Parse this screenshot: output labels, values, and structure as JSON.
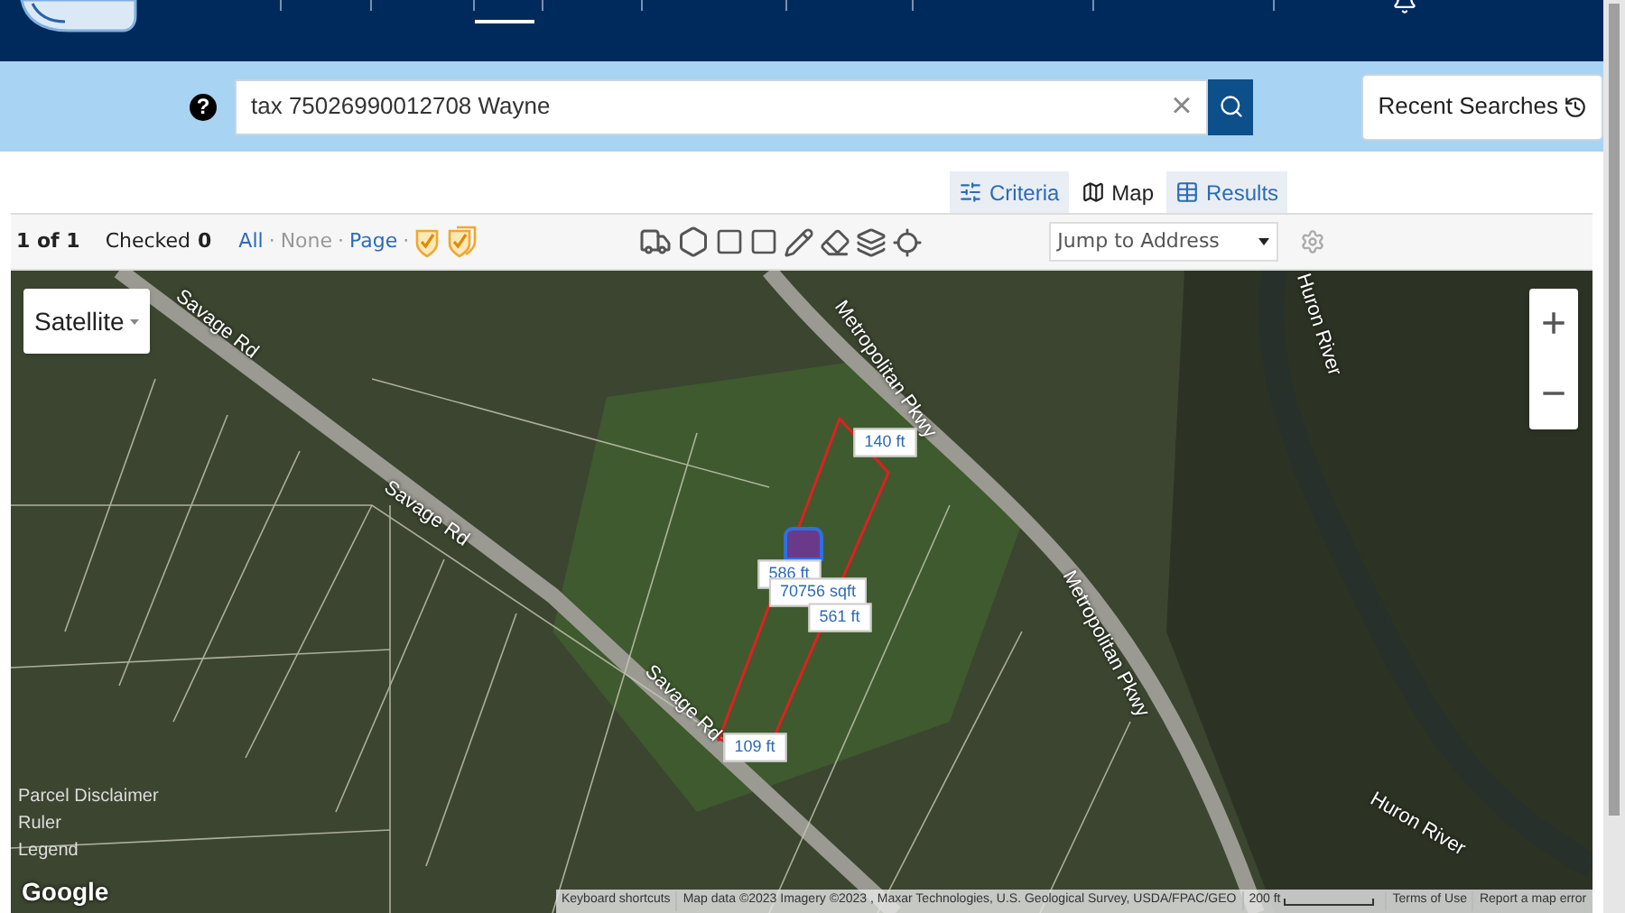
{
  "search": {
    "help": "?",
    "value": "tax 75026990012708 Wayne",
    "clear": "×"
  },
  "recent_searches": {
    "label": "Recent Searches"
  },
  "view_tabs": [
    {
      "label": "Criteria",
      "selected": false
    },
    {
      "label": "Map",
      "selected": true
    },
    {
      "label": "Results",
      "selected": false
    }
  ],
  "toolbar": {
    "page_count": "1 of 1",
    "checked_label": "Checked",
    "checked_count": "0",
    "select_links": [
      {
        "label": "All",
        "disabled": false,
        "separator": "·"
      },
      {
        "label": "None",
        "disabled": true,
        "separator": "·"
      },
      {
        "label": "Page",
        "disabled": false,
        "separator": "·"
      }
    ],
    "jump_placeholder": "Jump to Address"
  },
  "map": {
    "type_button": "Satellite",
    "zoom_in": "+",
    "zoom_out": "−",
    "road_labels": [
      {
        "text": "Metropolitan Pkwy"
      },
      {
        "text": "Metropolitan Pkwy"
      },
      {
        "text": "Savage Rd"
      },
      {
        "text": "Savage Rd"
      },
      {
        "text": "Savage Rd"
      },
      {
        "text": "Huron River"
      },
      {
        "text": "Huron River"
      }
    ],
    "measurements": [
      {
        "text": "140 ft"
      },
      {
        "text": "586 ft"
      },
      {
        "text": "70756 sqft"
      },
      {
        "text": "561 ft"
      },
      {
        "text": "109 ft"
      }
    ],
    "side_links": [
      "Parcel Disclaimer",
      "Ruler",
      "Legend"
    ],
    "logo": "Google",
    "attribution": {
      "shortcuts": "Keyboard shortcuts",
      "map_data": "Map data ©2023 Imagery ©2023 , Maxar Technologies, U.S. Geological Survey, USDA/FPAC/GEO",
      "scale": "200 ft",
      "terms": "Terms of Use",
      "report": "Report a map error"
    }
  }
}
